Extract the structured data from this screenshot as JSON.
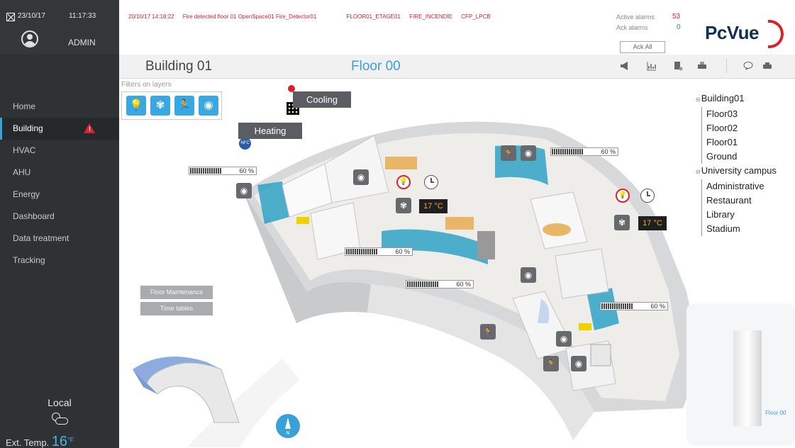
{
  "sidebar": {
    "date": "23/10/17",
    "time": "11:17:33",
    "user": "ADMIN",
    "nav": [
      {
        "label": "Home"
      },
      {
        "label": "Building"
      },
      {
        "label": "HVAC"
      },
      {
        "label": "AHU"
      },
      {
        "label": "Energy"
      },
      {
        "label": "Dashboard"
      },
      {
        "label": "Data treatment"
      },
      {
        "label": "Tracking"
      }
    ],
    "weather": {
      "location": "Local",
      "ext_label": "Ext. Temp.",
      "ext_value": "16",
      "unit": "°F"
    }
  },
  "alarm_bar": {
    "datetime": "20/10/17  14:18:22",
    "message": "Fire detected floor 01 OpenSpace01 Fire_Detector01",
    "tag1": "FLOOR01_ETAGE01",
    "tag2": "FIRE_INCENDIE",
    "tag3": "CFP_LPCB",
    "active_label": "Active alarms",
    "active_count": "53",
    "ack_label": "Ack alarms",
    "ack_count": "0",
    "ack_all_button": "Ack All"
  },
  "logo": {
    "text": "PcVue"
  },
  "header": {
    "building": "Building 01",
    "floor": "Floor 00"
  },
  "map": {
    "filters_label": "Filters on layers",
    "callouts": {
      "cooling": "Cooling",
      "heating": "Heating"
    },
    "gauges": [
      {
        "label": "60 %",
        "level": 0.6
      },
      {
        "label": "60 %",
        "level": 0.6
      },
      {
        "label": "60 %",
        "level": 0.6
      },
      {
        "label": "60 %",
        "level": 0.6
      },
      {
        "label": "60 %",
        "level": 0.6
      }
    ],
    "temps": [
      "17 °C",
      "17 °C"
    ],
    "buttons": {
      "maintenance": "Floor Maintenance",
      "timetables": "Time tables"
    },
    "thumbnail_label": "Floor 00"
  },
  "tree": [
    {
      "label": "Building01",
      "level": 0
    },
    {
      "label": "Floor03",
      "level": 1
    },
    {
      "label": "Floor02",
      "level": 1
    },
    {
      "label": "Floor01",
      "level": 1
    },
    {
      "label": "Ground",
      "level": 1
    },
    {
      "label": "University campus",
      "level": 0
    },
    {
      "label": "Administrative",
      "level": 1
    },
    {
      "label": "Restaurant",
      "level": 1
    },
    {
      "label": "Library",
      "level": 1
    },
    {
      "label": "Stadium",
      "level": 1
    }
  ],
  "colors": {
    "accent": "#3aa0d8",
    "alarm": "#d8232a",
    "ack_ok": "#27a33e",
    "sidebar": "#2f3234"
  },
  "icons": [
    "close-icon",
    "user-icon",
    "warning-icon",
    "weather-icon",
    "bulb-icon",
    "fan-icon",
    "motion-icon",
    "smoke-detector-icon",
    "clock-icon",
    "compass-icon"
  ]
}
